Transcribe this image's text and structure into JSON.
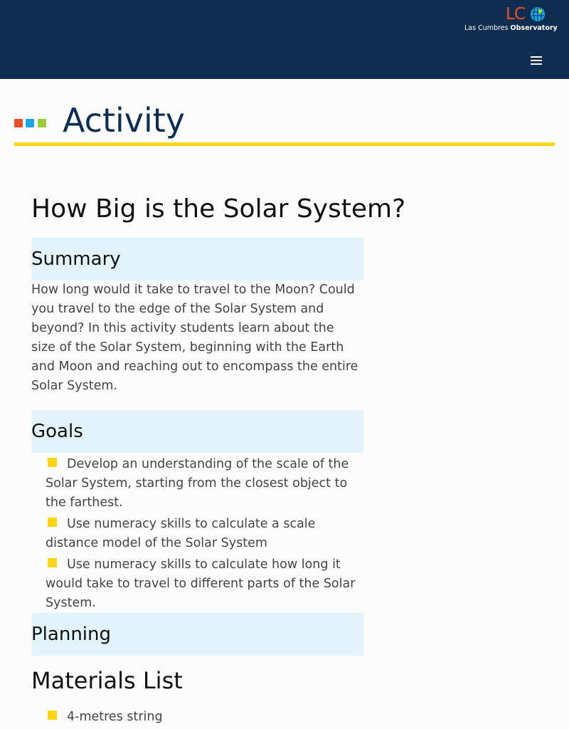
{
  "header": {
    "logo_mark": "LC",
    "logo_name_light": "Las Cumbres",
    "logo_name_bold": "Observatory",
    "menu_icon": "hamburger-menu-icon"
  },
  "banner": {
    "title": "Activity",
    "square_colors": [
      "#e6502b",
      "#1fa6e0",
      "#9ccc3b"
    ],
    "accent_color": "#fed617"
  },
  "main": {
    "title": "How Big is the Solar System?"
  },
  "summary": {
    "heading": "Summary",
    "text": "How long would it take to travel to the Moon? Could you travel to the edge of the Solar System and beyond? In this activity students learn about the size of the Solar System, beginning with the Earth and Moon and reaching out to encompass the entire Solar System."
  },
  "goals": {
    "heading": "Goals",
    "items": [
      "Develop an understanding of the scale of the Solar System, starting from the closest object to the farthest.",
      "Use numeracy skills to calculate a scale distance model of the Solar System",
      "Use numeracy skills to calculate how long it would take to travel to different parts of the Solar System."
    ]
  },
  "planning": {
    "heading": "Planning"
  },
  "materials": {
    "heading": "Materials List",
    "items": [
      "4-metres string"
    ]
  },
  "colors": {
    "header_bg": "#0f2d50",
    "section_bg": "#e2f3fb",
    "bullet": "#fed617"
  }
}
